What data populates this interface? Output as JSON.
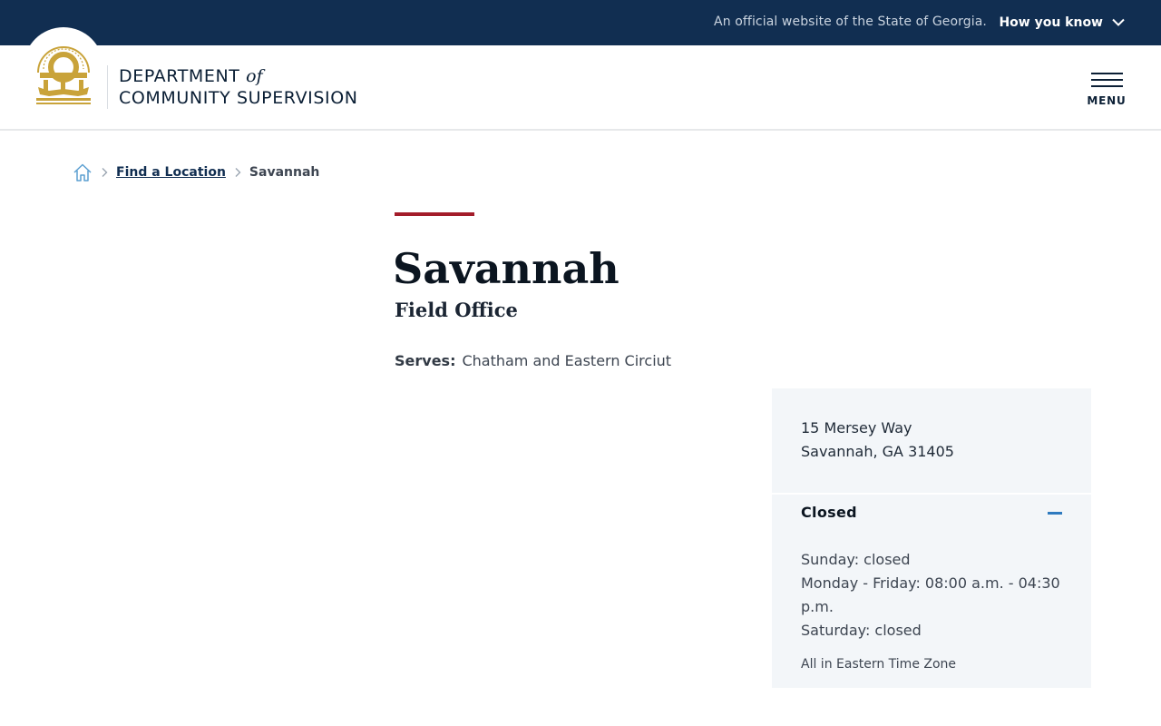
{
  "site_banner": {
    "official_text": "An official website of the State of Georgia.",
    "how_you_know_label": "How you know"
  },
  "header": {
    "logo_line1": "DEPARTMENT",
    "logo_of": "of",
    "logo_line2": "COMMUNITY SUPERVISION",
    "menu_label": "MENU"
  },
  "breadcrumb": {
    "items": [
      {
        "label": "Find a Location"
      },
      {
        "label": "Savannah"
      }
    ]
  },
  "location": {
    "title": "Savannah",
    "subtitle": "Field Office",
    "serves_label": "Serves:",
    "serves_value": "Chatham and Eastern Circiut",
    "address_line1": "15 Mersey Way",
    "address_line2": "Savannah, GA 31405",
    "status": "Closed",
    "hours": [
      "Sunday: closed",
      "Monday - Friday: 08:00 a.m. - 04:30 p.m.",
      "Saturday: closed"
    ],
    "timezone_note": "All in Eastern Time Zone"
  },
  "icons": {
    "seal": "georgia-seal-icon",
    "home": "home-icon",
    "separator": "chevron-right-icon",
    "expand": "chevron-down-icon",
    "menu": "hamburger-icon",
    "collapse": "minus-icon"
  },
  "colors": {
    "banner_bg": "#112e51",
    "accent_red": "#a31c2a",
    "seal_gold": "#c9a33a",
    "card_bg": "#f3f6f9",
    "link_blue": "#2e7abf"
  }
}
